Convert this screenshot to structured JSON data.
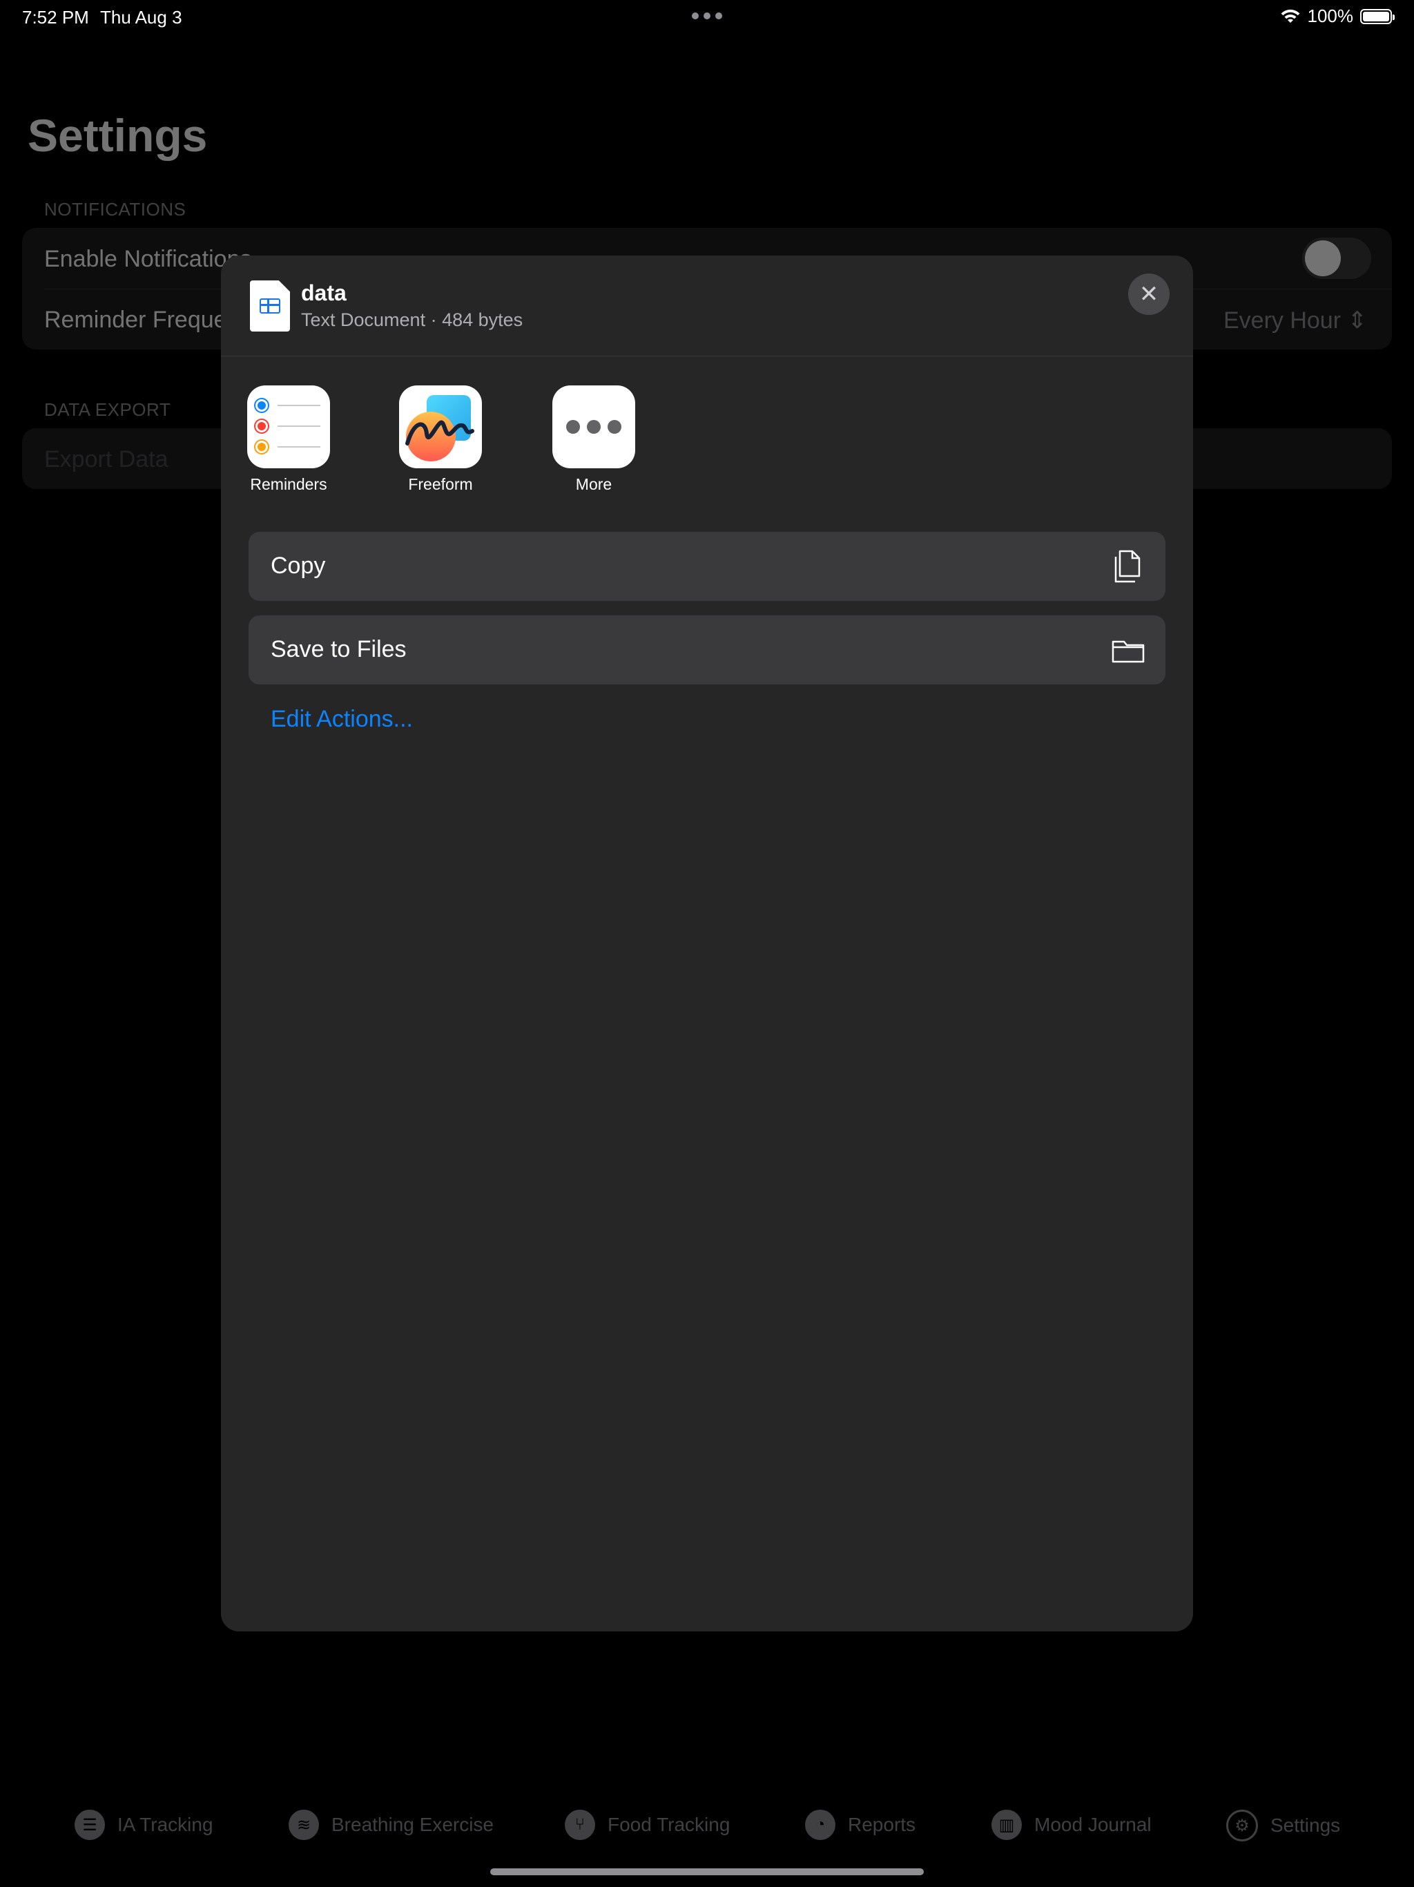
{
  "status_bar": {
    "time": "7:52 PM",
    "date": "Thu Aug 3",
    "battery": "100%"
  },
  "settings": {
    "title": "Settings",
    "notifications": {
      "header": "NOTIFICATIONS",
      "enable_label": "Enable Notifications",
      "enable_on": false,
      "reminder_label": "Reminder Frequency",
      "reminder_value": "Every Hour"
    },
    "data_export": {
      "header": "DATA EXPORT",
      "export_label": "Export Data"
    }
  },
  "tab_bar": {
    "tabs": [
      {
        "label": "IA Tracking",
        "icon": "list-icon"
      },
      {
        "label": "Breathing Exercise",
        "icon": "wind-icon"
      },
      {
        "label": "Food Tracking",
        "icon": "fork-knife-icon"
      },
      {
        "label": "Reports",
        "icon": "pie-chart-icon"
      },
      {
        "label": "Mood Journal",
        "icon": "book-icon"
      },
      {
        "label": "Settings",
        "icon": "gear-icon"
      }
    ]
  },
  "share_sheet": {
    "file_name": "data",
    "file_meta": "Text Document · 484 bytes",
    "apps": [
      {
        "label": "Reminders",
        "icon": "reminders-app-icon"
      },
      {
        "label": "Freeform",
        "icon": "freeform-app-icon"
      },
      {
        "label": "More",
        "icon": "more-icon"
      }
    ],
    "actions": [
      {
        "label": "Copy",
        "icon": "copy-icon"
      },
      {
        "label": "Save to Files",
        "icon": "folder-icon"
      }
    ],
    "edit_actions": "Edit Actions...",
    "colors": {
      "link": "#0a84ff",
      "sheet_bg": "#262626",
      "action_bg": "#3a3a3c"
    }
  }
}
